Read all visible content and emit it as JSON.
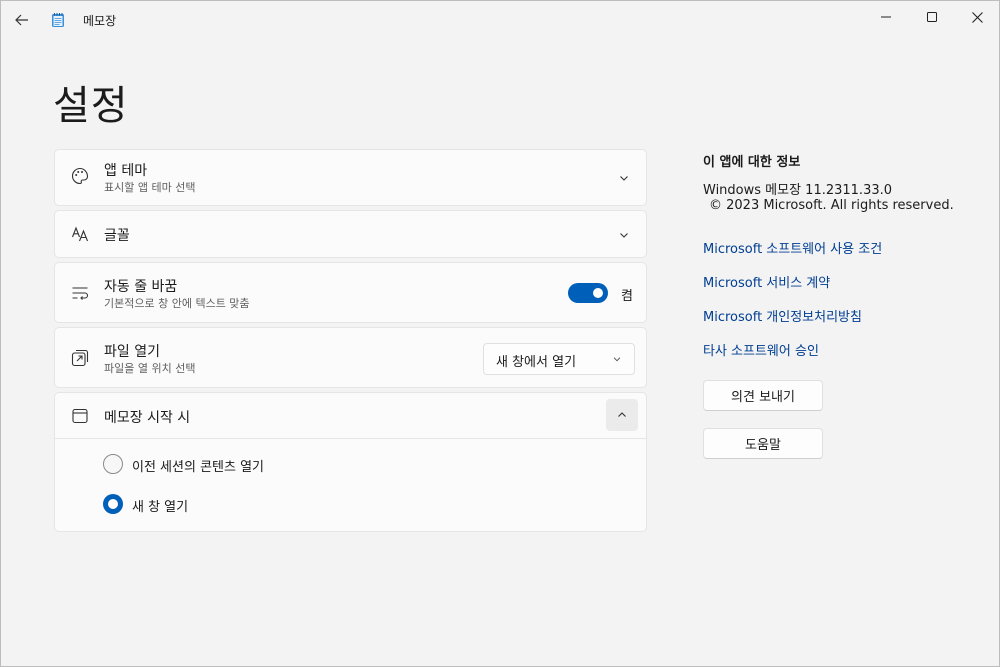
{
  "window": {
    "app_title": "메모장"
  },
  "page": {
    "title": "설정"
  },
  "settings": {
    "theme": {
      "title": "앱 테마",
      "subtitle": "표시할 앱 테마 선택"
    },
    "font": {
      "title": "글꼴"
    },
    "word_wrap": {
      "title": "자동 줄 바꿈",
      "subtitle": "기본적으로 창 안에 텍스트 맞춤",
      "state_label": "켬",
      "enabled": true
    },
    "open_file": {
      "title": "파일 열기",
      "subtitle": "파일을 열 위치 선택",
      "selected": "새 창에서 열기"
    },
    "startup": {
      "title": "메모장 시작 시",
      "options": [
        {
          "label": "이전 세션의 콘텐츠 열기",
          "selected": false
        },
        {
          "label": "새 창 열기",
          "selected": true
        }
      ]
    }
  },
  "about": {
    "heading": "이 앱에 대한 정보",
    "version": "Windows 메모장 11.2311.33.0",
    "copyright": "© 2023 Microsoft. All rights reserved.",
    "links": [
      "Microsoft 소프트웨어 사용 조건",
      "Microsoft 서비스 계약",
      "Microsoft 개인정보처리방침",
      "타사 소프트웨어 승인"
    ],
    "feedback_button": "의견 보내기",
    "help_button": "도움말"
  },
  "colors": {
    "accent": "#005fb8",
    "link": "#003e92",
    "background": "#f3f3f3"
  }
}
